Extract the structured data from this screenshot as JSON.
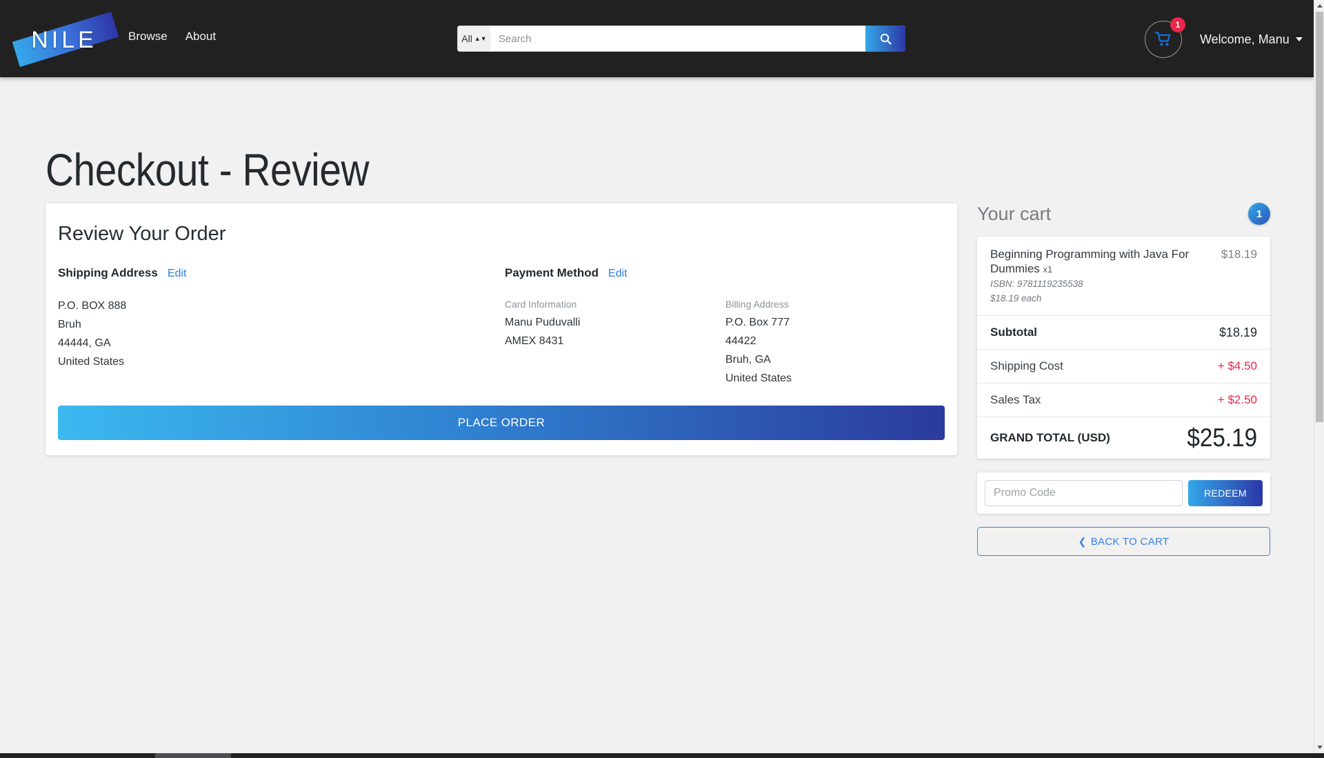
{
  "navbar": {
    "logo_text": "NILE",
    "links": [
      {
        "label": "Browse"
      },
      {
        "label": "About"
      }
    ],
    "search": {
      "scope_label": "All",
      "placeholder": "Search",
      "value": "",
      "button_icon": "search-icon"
    },
    "cart": {
      "icon": "shopping-cart-icon",
      "badge_count": "1"
    },
    "account": {
      "label": "Welcome, Manu",
      "caret_icon": "chevron-down-icon"
    }
  },
  "page": {
    "title": "Checkout - Review"
  },
  "order_card": {
    "heading": "Review Your Order",
    "shipping": {
      "title": "Shipping Address",
      "edit_label": "Edit",
      "lines": [
        "P.O. BOX 888",
        "Bruh",
        "44444, GA",
        "United States"
      ]
    },
    "payment": {
      "title": "Payment Method",
      "edit_label": "Edit",
      "card_information": {
        "label": "Card Information",
        "lines": [
          "Manu Puduvalli",
          "AMEX 8431"
        ]
      },
      "billing_address": {
        "label": "Billing Address",
        "lines": [
          "P.O. Box 777",
          "44422",
          "Bruh, GA",
          "United States"
        ]
      }
    },
    "place_order_label": "PLACE ORDER"
  },
  "cart_panel": {
    "title": "Your cart",
    "count_badge": "1",
    "items": [
      {
        "title": "Beginning Programming with Java For Dummies",
        "qty": "x1",
        "isbn": "ISBN: 9781119235538",
        "unit_price": "$18.19 each",
        "line_price": "$18.19"
      }
    ],
    "totals": [
      {
        "label": "Subtotal",
        "value": "$18.19",
        "bold": true,
        "accent": false
      },
      {
        "label": "Shipping Cost",
        "value": "+ $4.50",
        "bold": false,
        "accent": true
      },
      {
        "label": "Sales Tax",
        "value": "+ $2.50",
        "bold": false,
        "accent": true
      }
    ],
    "grand_total": {
      "label": "GRAND TOTAL (USD)",
      "value": "$25.19"
    },
    "promo": {
      "placeholder": "Promo Code",
      "value": "",
      "redeem_label": "REDEEM"
    },
    "back_to_cart": {
      "label": "BACK TO CART",
      "chevron_icon": "chevron-left-icon"
    }
  },
  "colors": {
    "navbar_bg": "#212121",
    "page_bg": "#f1f1f1",
    "accent_blue_light": "#35a8e8",
    "accent_blue_dark": "#2b3a9d",
    "link_blue": "#2a7fe0",
    "accent_red": "#e8274b",
    "badge_red": "#e8274b"
  }
}
